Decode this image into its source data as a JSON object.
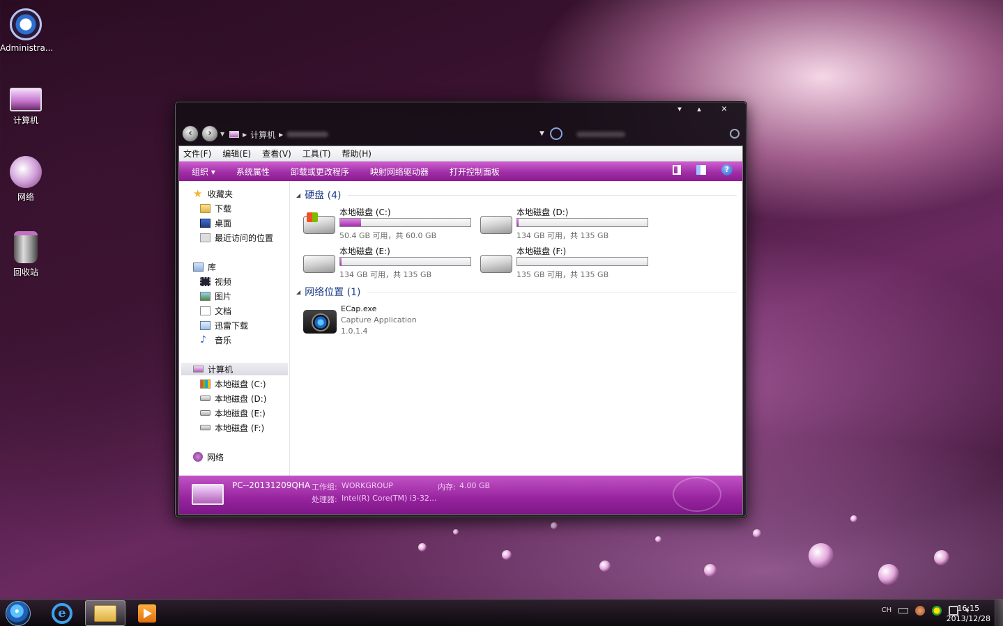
{
  "desktop": {
    "icons": [
      {
        "label": "Administra..."
      },
      {
        "label": "计算机"
      },
      {
        "label": "网络"
      },
      {
        "label": "回收站"
      }
    ]
  },
  "window": {
    "caption_buttons": {
      "minimize": "▾",
      "maximize": "▴",
      "close": "✕"
    },
    "address": {
      "path_item": "计算机"
    },
    "menubar": [
      "文件(F)",
      "编辑(E)",
      "查看(V)",
      "工具(T)",
      "帮助(H)"
    ],
    "toolbar": {
      "organize": "组织 ▾",
      "items": [
        "系统属性",
        "卸载或更改程序",
        "映射网络驱动器",
        "打开控制面板"
      ]
    },
    "nav": {
      "favorites": "收藏夹",
      "favorites_items": [
        "下载",
        "桌面",
        "最近访问的位置"
      ],
      "libraries": "库",
      "library_items": [
        "视频",
        "图片",
        "文档",
        "迅雷下载",
        "音乐"
      ],
      "computer": "计算机",
      "computer_items": [
        "本地磁盘 (C:)",
        "本地磁盘 (D:)",
        "本地磁盘 (E:)",
        "本地磁盘 (F:)"
      ],
      "network": "网络"
    },
    "content": {
      "hard_disks_header": "硬盘 (4)",
      "drives": [
        {
          "name": "本地磁盘 (C:)",
          "size": "50.4 GB 可用，共 60.0 GB",
          "used_fraction": 0.16
        },
        {
          "name": "本地磁盘 (D:)",
          "size": "134 GB 可用，共 135 GB",
          "used_fraction": 0.01
        },
        {
          "name": "本地磁盘 (E:)",
          "size": "134 GB 可用，共 135 GB",
          "used_fraction": 0.01
        },
        {
          "name": "本地磁盘 (F:)",
          "size": "135 GB 可用，共 135 GB",
          "used_fraction": 0.0
        }
      ],
      "network_header": "网络位置 (1)",
      "network_item": {
        "name": "ECap.exe",
        "desc": "Capture Application",
        "version": "1.0.1.4"
      }
    },
    "details": {
      "pc_name": "PC--20131209QHA",
      "workgroup_label": "工作组:",
      "workgroup": "WORKGROUP",
      "memory_label": "内存:",
      "memory": "4.00 GB",
      "cpu_label": "处理器:",
      "cpu": "Intel(R) Core(TM) i3-32..."
    }
  },
  "taskbar": {
    "tray_lang": "CH",
    "time": "16:15",
    "date": "2013/12/28"
  }
}
